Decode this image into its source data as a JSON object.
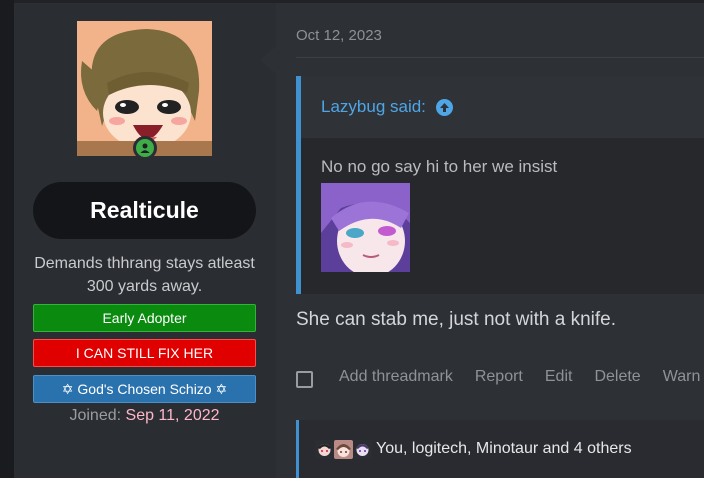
{
  "user": {
    "username": "Realticule",
    "title": "Demands thhrang stays atleast 300 yards away.",
    "banners": [
      "Early Adopter",
      "I CAN STILL FIX HER",
      "✡ God's Chosen Schizo ✡"
    ],
    "joined_label": "Joined:",
    "joined_date": "Sep 11, 2022",
    "status": "online"
  },
  "post": {
    "date": "Oct 12, 2023",
    "quote": {
      "author": "Lazybug said:",
      "text": "No no go say hi to her we insist"
    },
    "body": "She can stab me, just not with a knife.",
    "actions": [
      "Add threadmark",
      "Report",
      "Edit",
      "Delete",
      "Warn"
    ],
    "reactions_text": "You, logitech, Minotaur and 4 others"
  },
  "colors": {
    "accent": "#3f91d0",
    "link": "#4ea6e6",
    "banner_green": "#0b8a10",
    "banner_red": "#e00000",
    "banner_blue": "#2a72ad",
    "joined_date": "#ffb6c8"
  },
  "icons": [
    "online-status-icon",
    "jump-to-quote-icon",
    "checkbox-icon"
  ]
}
